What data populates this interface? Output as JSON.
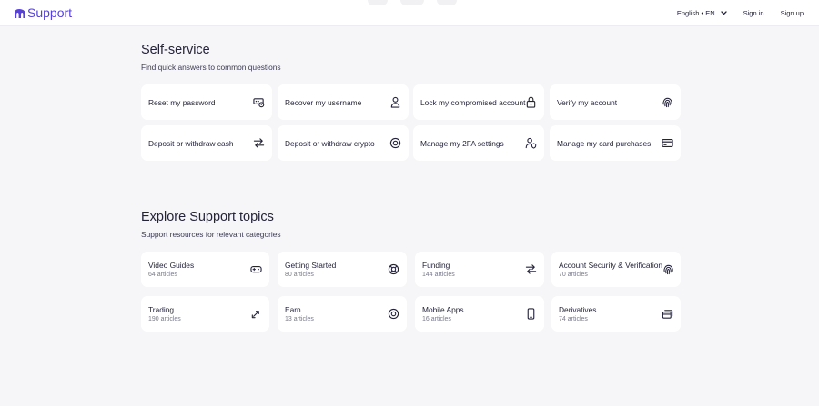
{
  "header": {
    "brand": "Support",
    "language": "English • EN",
    "sign_in": "Sign in",
    "sign_up": "Sign up"
  },
  "self_service": {
    "title": "Self-service",
    "subtitle": "Find quick answers to common questions",
    "items": [
      {
        "label": "Reset my password",
        "icon": "password-key-icon"
      },
      {
        "label": "Recover my username",
        "icon": "user-icon"
      },
      {
        "label": "Lock my compromised account",
        "icon": "lock-icon"
      },
      {
        "label": "Verify my account",
        "icon": "fingerprint-icon"
      },
      {
        "label": "Deposit or withdraw cash",
        "icon": "transfer-arrows-icon"
      },
      {
        "label": "Deposit or withdraw crypto",
        "icon": "crypto-coin-icon"
      },
      {
        "label": "Manage my 2FA settings",
        "icon": "user-shield-icon"
      },
      {
        "label": "Manage my card purchases",
        "icon": "card-icon"
      }
    ]
  },
  "topics": {
    "title": "Explore Support topics",
    "subtitle": "Support resources for relevant categories",
    "items": [
      {
        "label": "Video Guides",
        "count": "64 articles",
        "icon": "gamepad-icon"
      },
      {
        "label": "Getting Started",
        "count": "80 articles",
        "icon": "lifebuoy-icon"
      },
      {
        "label": "Funding",
        "count": "144 articles",
        "icon": "transfer-arrows-icon"
      },
      {
        "label": "Account Security & Verification",
        "count": "70 articles",
        "icon": "fingerprint-icon"
      },
      {
        "label": "Trading",
        "count": "190 articles",
        "icon": "trade-arrows-icon"
      },
      {
        "label": "Earn",
        "count": "13 articles",
        "icon": "coin-icon"
      },
      {
        "label": "Mobile Apps",
        "count": "16 articles",
        "icon": "phone-icon"
      },
      {
        "label": "Derivatives",
        "count": "74 articles",
        "icon": "stacked-cards-icon"
      }
    ]
  },
  "colors": {
    "brand": "#5741d9",
    "background": "#f6f6f8",
    "card": "#ffffff",
    "text": "#24233a"
  }
}
